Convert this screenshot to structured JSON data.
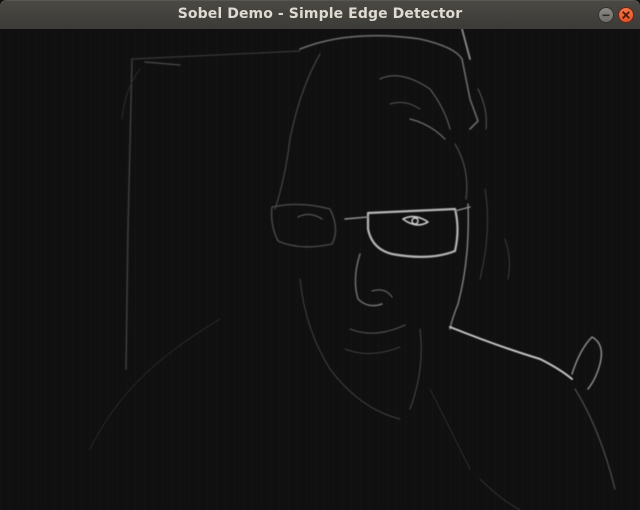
{
  "window": {
    "title": "Sobel Demo - Simple Edge Detector"
  },
  "titlebar": {
    "minimize_icon": "minimize-icon",
    "close_icon": "close-icon",
    "close_color": "#e95420"
  },
  "view": {
    "content": "sobel-edge-image",
    "background_color": "#101010",
    "edge_color": "#bdbdbd"
  }
}
